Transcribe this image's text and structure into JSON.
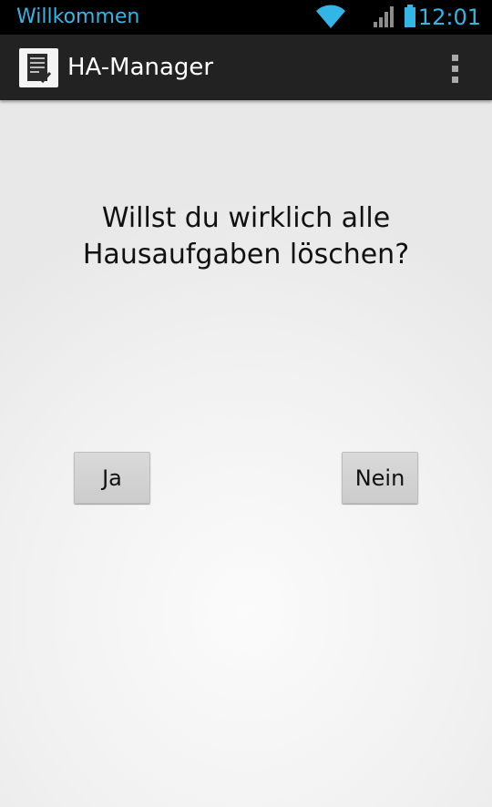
{
  "status_bar": {
    "notification": "Willkommen",
    "time": "12:01",
    "icons": [
      "wifi-icon",
      "signal-icon",
      "battery-icon"
    ],
    "accent_color": "#33b5e5"
  },
  "action_bar": {
    "title": "HA-Manager",
    "app_icon": "document-check-icon",
    "overflow_icon": "overflow-menu-icon"
  },
  "dialog": {
    "question": "Willst du wirklich alle Hausaufgaben löschen?",
    "yes_label": "Ja",
    "no_label": "Nein"
  }
}
